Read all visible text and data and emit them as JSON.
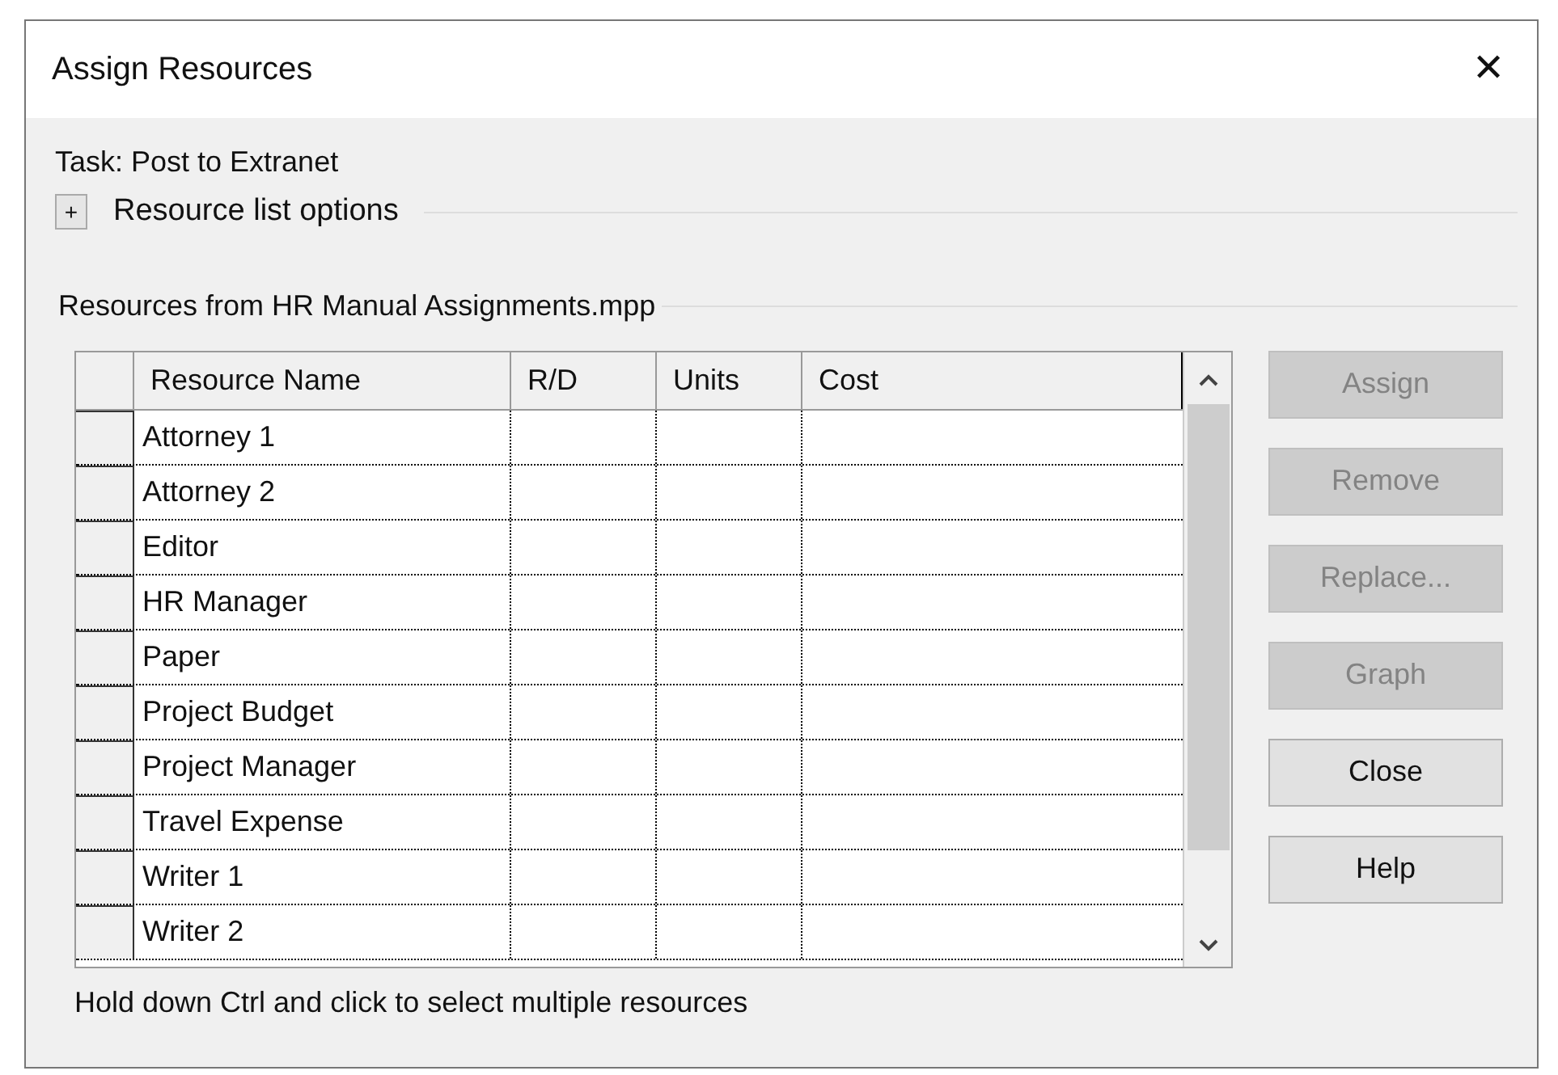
{
  "window": {
    "title": "Assign Resources",
    "close": "✕"
  },
  "task": "Task: Post to Extranet",
  "options": {
    "toggle": "+",
    "label": "Resource list options",
    "expanded": false
  },
  "resources_label": "Resources from HR Manual Assignments.mpp",
  "table": {
    "columns": [
      "Resource Name",
      "R/D",
      "Units",
      "Cost"
    ],
    "rows": [
      {
        "name": "Attorney 1"
      },
      {
        "name": "Attorney 2"
      },
      {
        "name": "Editor"
      },
      {
        "name": "HR Manager"
      },
      {
        "name": "Paper"
      },
      {
        "name": "Project Budget"
      },
      {
        "name": "Project Manager"
      },
      {
        "name": "Travel Expense"
      },
      {
        "name": "Writer 1"
      },
      {
        "name": "Writer 2"
      }
    ]
  },
  "buttons": [
    {
      "label": "Assign",
      "disabled": true
    },
    {
      "label": "Remove",
      "disabled": true
    },
    {
      "label": "Replace...",
      "disabled": true
    },
    {
      "label": "Graph",
      "disabled": true
    },
    {
      "label": "Close",
      "disabled": false
    },
    {
      "label": "Help",
      "disabled": false
    }
  ],
  "hint": "Hold down Ctrl and click to select multiple resources"
}
